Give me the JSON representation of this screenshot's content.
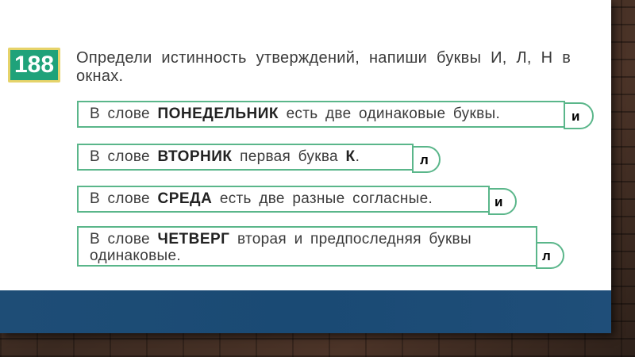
{
  "task": {
    "number": "188",
    "instruction": "Определи истинность утверждений, напиши буквы И, Л, Н в окнах."
  },
  "statements": [
    {
      "prefix": "В слове",
      "word": "ПОНЕДЕЛЬНИК",
      "suffix": "есть две одинаковые буквы.",
      "answer": "и"
    },
    {
      "prefix": "В слове",
      "word": "ВТОРНИК",
      "suffix": "первая буква",
      "bold_end": "К",
      "end": ".",
      "answer": "л"
    },
    {
      "prefix": "В слове",
      "word": "СРЕДА",
      "suffix": "есть две разные согласные.",
      "answer": "и"
    },
    {
      "prefix": "В слове",
      "word": "ЧЕТВЕРГ",
      "suffix": "вторая и предпоследняя буквы одинаковые.",
      "answer": "л"
    }
  ],
  "colors": {
    "badge": "#1fa27a",
    "badge_border": "#e6d36a",
    "box_border": "#5ab68a",
    "footer": "#1a4a74"
  }
}
